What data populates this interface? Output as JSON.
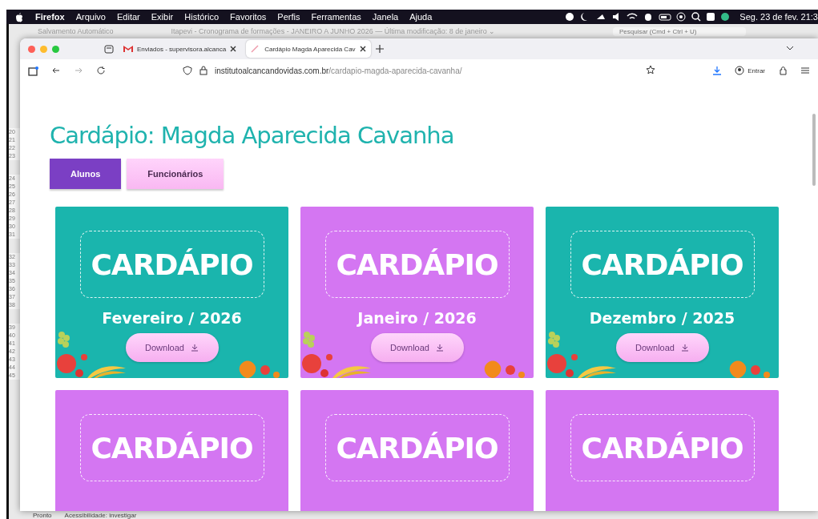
{
  "menubar": {
    "app": "Firefox",
    "items": [
      "Arquivo",
      "Editar",
      "Exibir",
      "Histórico",
      "Favoritos",
      "Perfis",
      "Ferramentas",
      "Janela",
      "Ajuda"
    ],
    "clock": "Seg. 23 de fev. 21:3"
  },
  "background_app": {
    "autosave": "Salvamento Automático",
    "title": "Itapevi - Cronograma de formações - JANEIRO A JUNHO 2026 — Última modificação: 8 de janeiro ⌄",
    "search": {
      "placeholder": "Pesquisar (Cmd + Ctrl + U)"
    },
    "row_groups": [
      [
        "20",
        "21",
        "22",
        "23"
      ],
      [
        "24",
        "25",
        "26",
        "27",
        "28",
        "29",
        "30",
        "31"
      ],
      [
        "32",
        "33",
        "34",
        "35",
        "36",
        "37",
        "38"
      ],
      [
        "39",
        "40",
        "41",
        "42",
        "43",
        "44",
        "45"
      ]
    ],
    "status_bar": [
      "Pronto",
      "Acessibilidade: investigar"
    ]
  },
  "browser": {
    "tabs": [
      {
        "title": "Enviados - supervisora.alcanca",
        "selected": false
      },
      {
        "title": "Cardápio Magda Aparecida Cav",
        "selected": true
      }
    ],
    "url": {
      "host": "institutoalcancandovidas.com.br",
      "path": "/cardapio-magda-aparecida-cavanha/"
    },
    "account": "Entrar"
  },
  "page": {
    "heading": "Cardápio: Magda Aparecida Cavanha",
    "filters": [
      {
        "label": "Alunos",
        "selected": true
      },
      {
        "label": "Funcionários",
        "selected": false
      }
    ],
    "cards": [
      {
        "title": "CARDÁPIO",
        "month": "Fevereiro / 2026",
        "button": "Download",
        "color": "#1ab5ad"
      },
      {
        "title": "CARDÁPIO",
        "month": "Janeiro / 2026",
        "button": "Download",
        "color": "#d476f2"
      },
      {
        "title": "CARDÁPIO",
        "month": "Dezembro / 2025",
        "button": "Download",
        "color": "#1ab5ad"
      },
      {
        "title": "CARDÁPIO",
        "color": "#d476f2"
      },
      {
        "title": "CARDÁPIO",
        "color": "#d476f2"
      },
      {
        "title": "CARDÁPIO",
        "color": "#d476f2"
      }
    ]
  }
}
